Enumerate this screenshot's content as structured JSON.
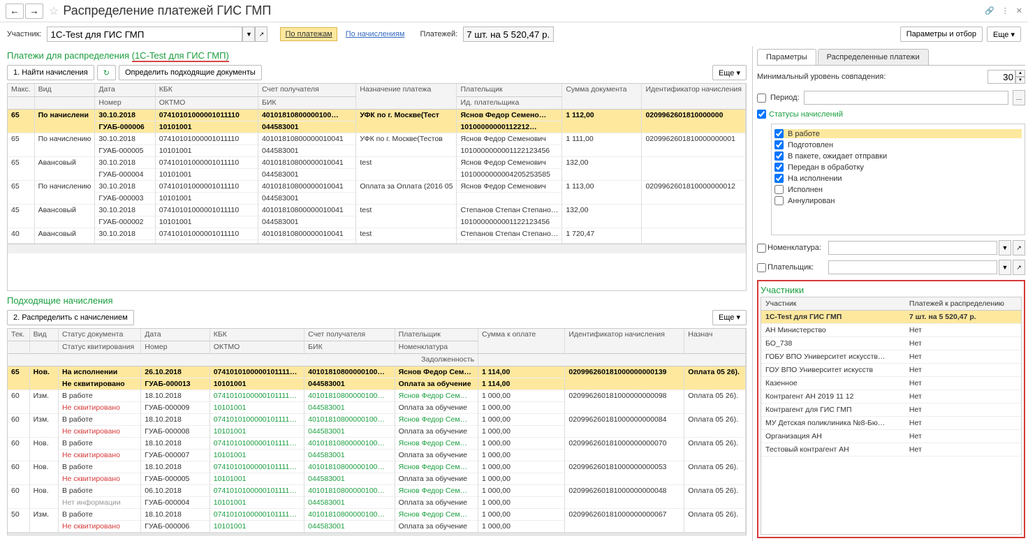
{
  "title": "Распределение платежей ГИС ГМП",
  "toolbar": {
    "participant_label": "Участник:",
    "participant_value": "1C-Test для ГИС ГМП",
    "by_payments": "По платежам",
    "by_charges": "По начислениям",
    "payments_label": "Платежей:",
    "payments_value": "7 шт. на 5 520,47 р.",
    "params_filter": "Параметры и отбор",
    "more": "Еще"
  },
  "sec1": {
    "title_a": "Платежи для распределения ",
    "title_b": "(1C-Test для ГИС ГМП)",
    "btn_find": "1. Найти начисления",
    "btn_matching": "Определить подходящие документы",
    "more": "Еще"
  },
  "grid1": {
    "h": {
      "max": "Макс.",
      "vid": "Вид",
      "date": "Дата",
      "num": "Номер",
      "kbk": "КБК",
      "oktmo": "ОКТМО",
      "acct": "Счет получателя",
      "bik": "БИК",
      "purp": "Назначение платежа",
      "payer": "Плательщик",
      "payerid": "Ид. плательщика",
      "sum": "Сумма документа",
      "idn": "Идентификатор начисления"
    },
    "rows": [
      {
        "sel": true,
        "max": "65",
        "vid": "По начислени",
        "date": "30.10.2018",
        "num": "ГУАБ-000006",
        "kbk": "07410101000001011110",
        "oktmo": "10101001",
        "acct": "40101810800000100…",
        "bik": "044583001",
        "purp": "УФК по г. Москве(Тест",
        "payer": "Яснов Федор Семено…",
        "payerid": "10100000000112212…",
        "sum": "1 112,00",
        "id": "0209962601810000000"
      },
      {
        "max": "65",
        "vid": "По начислению",
        "date": "30.10.2018",
        "num": "ГУАБ-000005",
        "kbk": "07410101000001011110",
        "oktmo": "10101001",
        "acct": "40101810800000010041",
        "bik": "044583001",
        "purp": "УФК по г. Москве(Тестов",
        "payer": "Яснов Федор Семенович",
        "payerid": "1010000000001122123456",
        "sum": "1 111,00",
        "id": "0209962601810000000001"
      },
      {
        "max": "65",
        "vid": "Авансовый",
        "date": "30.10.2018",
        "num": "ГУАБ-000004",
        "kbk": "07410101000001011110",
        "oktmo": "10101001",
        "acct": "40101810800000010041",
        "bik": "044583001",
        "purp": "test",
        "payer": "Яснов Федор Семенович",
        "payerid": "1010000000004205253585",
        "sum": "132,00",
        "id": ""
      },
      {
        "max": "65",
        "vid": "По начислению",
        "date": "30.10.2018",
        "num": "ГУАБ-000003",
        "kbk": "07410101000001011110",
        "oktmo": "10101001",
        "acct": "40101810800000010041",
        "bik": "044583001",
        "purp": "Оплата за Оплата (2016 05",
        "payer": "Яснов Федор Семенович",
        "payerid": "",
        "sum": "1 113,00",
        "id": "0209962601810000000012"
      },
      {
        "max": "45",
        "vid": "Авансовый",
        "date": "30.10.2018",
        "num": "ГУАБ-000002",
        "kbk": "07410101000001011110",
        "oktmo": "10101001",
        "acct": "40101810800000010041",
        "bik": "044583001",
        "purp": "test",
        "payer": "Степанов Степан Степано…",
        "payerid": "1010000000001122123456",
        "sum": "132,00",
        "id": ""
      },
      {
        "max": "40",
        "vid": "Авансовый",
        "date": "30.10.2018",
        "num": "",
        "kbk": "07410101000001011110",
        "oktmo": "",
        "acct": "40101810800000010041",
        "bik": "",
        "purp": "test",
        "payer": "Степанов Степан Степано…",
        "payerid": "",
        "sum": "1 720,47",
        "id": ""
      }
    ]
  },
  "sec2": {
    "title": "Подходящие начисления",
    "btn_dist": "2. Распределить с начислением",
    "more": "Еще"
  },
  "grid2": {
    "h": {
      "tek": "Тек.",
      "vid": "Вид",
      "stdoc": "Статус документа",
      "stkv": "Статус квитирования",
      "date": "Дата",
      "num": "Номер",
      "kbk": "КБК",
      "oktmo": "ОКТМО",
      "acct": "Счет получателя",
      "bik": "БИК",
      "payer": "Плательщик",
      "nomen": "Номенклатура",
      "sum": "Сумма к оплате",
      "debt": "Задолженность",
      "id": "Идентификатор начисления",
      "purp": "Назнач"
    },
    "rows": [
      {
        "sel": true,
        "tek": "65",
        "vid": "Нов.",
        "stdoc": "На исполнении",
        "stkv": "Не сквитировано",
        "kvred": true,
        "date": "26.10.2018",
        "num": "ГУАБ-000013",
        "kbk": "0741010100000101111…",
        "oktmo": "10101001",
        "acct": "40101810800000100…",
        "bik": "044583001",
        "payer": "Яснов Федор Сем…",
        "nomen": "Оплата за обучение",
        "sum": "1 114,00",
        "debt": "1 114,00",
        "id": "020996260181000000000139",
        "purp": "Оплата 05 26)."
      },
      {
        "tek": "60",
        "vid": "Изм.",
        "stdoc": "В работе",
        "stkv": "Не сквитировано",
        "kvred": true,
        "date": "18.10.2018",
        "num": "ГУАБ-000009",
        "kbk": "0741010100000101111…",
        "oktmo": "10101001",
        "acct": "40101810800000100…",
        "bik": "044583001",
        "payer": "Яснов Федор Сем…",
        "nomen": "Оплата за обучение",
        "sum": "1 000,00",
        "debt": "1 000,00",
        "id": "020996260181000000000098",
        "purp": "Оплата 05 26)."
      },
      {
        "tek": "60",
        "vid": "Изм.",
        "stdoc": "В работе",
        "stkv": "Не сквитировано",
        "kvred": true,
        "date": "18.10.2018",
        "num": "ГУАБ-000008",
        "kbk": "0741010100000101111…",
        "oktmo": "10101001",
        "acct": "40101810800000100…",
        "bik": "044583001",
        "payer": "Яснов Федор Сем…",
        "nomen": "Оплата за обучение",
        "sum": "1 000,00",
        "debt": "1 000,00",
        "id": "020996260181000000000084",
        "purp": "Оплата 05 26)."
      },
      {
        "tek": "60",
        "vid": "Нов.",
        "stdoc": "В работе",
        "stkv": "Не сквитировано",
        "kvred": true,
        "date": "18.10.2018",
        "num": "ГУАБ-000007",
        "kbk": "0741010100000101111…",
        "oktmo": "10101001",
        "acct": "40101810800000100…",
        "bik": "044583001",
        "payer": "Яснов Федор Сем…",
        "nomen": "Оплата за обучение",
        "sum": "1 000,00",
        "debt": "1 000,00",
        "id": "020996260181000000000070",
        "purp": "Оплата 05 26)."
      },
      {
        "tek": "60",
        "vid": "Нов.",
        "stdoc": "В работе",
        "stkv": "Не сквитировано",
        "kvred": true,
        "date": "18.10.2018",
        "num": "ГУАБ-000005",
        "kbk": "0741010100000101111…",
        "oktmo": "10101001",
        "acct": "40101810800000100…",
        "bik": "044583001",
        "payer": "Яснов Федор Сем…",
        "nomen": "Оплата за обучение",
        "sum": "1 000,00",
        "debt": "1 000,00",
        "id": "020996260181000000000053",
        "purp": "Оплата 05 26)."
      },
      {
        "tek": "60",
        "vid": "Нов.",
        "stdoc": "В работе",
        "stkv": "Нет информации",
        "kvgray": true,
        "date": "06.10.2018",
        "num": "ГУАБ-000004",
        "kbk": "0741010100000101111…",
        "oktmo": "10101001",
        "acct": "40101810800000100…",
        "bik": "044583001",
        "payer": "Яснов Федор Сем…",
        "nomen": "Оплата за обучение",
        "sum": "1 000,00",
        "debt": "1 000,00",
        "id": "020996260181000000000048",
        "purp": "Оплата 05 26)."
      },
      {
        "tek": "50",
        "vid": "Изм.",
        "stdoc": "В работе",
        "stkv": "Не сквитировано",
        "kvred": true,
        "date": "18.10.2018",
        "num": "ГУАБ-000006",
        "kbk": "0741010100000101111…",
        "oktmo": "10101001",
        "acct": "40101810800000100…",
        "bik": "044583001",
        "payer": "Яснов Федор Сем…",
        "nomen": "Оплата за обучение",
        "sum": "1 000,00",
        "debt": "1 000,00",
        "id": "020996260181000000000067",
        "purp": "Оплата 05 26)."
      }
    ]
  },
  "panel": {
    "tab1": "Параметры",
    "tab2": "Распределенные платежи",
    "min_match": "Минимальный уровень совпадения:",
    "min_val": "30",
    "period": "Период:",
    "statuses_header": "Статусы начислений",
    "statuses": [
      {
        "label": "В работе",
        "checked": true,
        "sel": true
      },
      {
        "label": "Подготовлен",
        "checked": true
      },
      {
        "label": "В пакете, ожидает отправки",
        "checked": true
      },
      {
        "label": "Передан в обработку",
        "checked": true
      },
      {
        "label": "На исполнении",
        "checked": true
      },
      {
        "label": "Исполнен",
        "checked": false
      },
      {
        "label": "Аннулирован",
        "checked": false
      }
    ],
    "nomen": "Номенклатура:",
    "payer": "Плательщик:",
    "participants_title": "Участники",
    "pt_h1": "Участник",
    "pt_h2": "Платежей к распределению",
    "participants": [
      {
        "name": "1C-Test для ГИС ГМП",
        "val": "7 шт. на 5 520,47 р.",
        "sel": true
      },
      {
        "name": "АН Министерство",
        "val": "Нет"
      },
      {
        "name": "БО_738",
        "val": "Нет"
      },
      {
        "name": "ГОБУ ВПО Университет искусств…",
        "val": "Нет"
      },
      {
        "name": "ГОУ ВПО Университет искусств",
        "val": "Нет"
      },
      {
        "name": "Казенное",
        "val": "Нет"
      },
      {
        "name": "Контрагент АН 2019 11 12",
        "val": "Нет"
      },
      {
        "name": "Контрагент для ГИС ГМП",
        "val": "Нет"
      },
      {
        "name": "МУ Детская поликлиника №8-Бю…",
        "val": "Нет"
      },
      {
        "name": "Организация АН",
        "val": "Нет"
      },
      {
        "name": "Тестовый контрагент АН",
        "val": "Нет"
      }
    ]
  }
}
